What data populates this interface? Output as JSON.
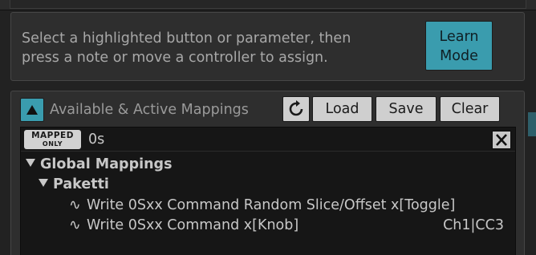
{
  "hint": {
    "line1": "Select a highlighted button or parameter, then",
    "line2": "press a note or move a controller to assign.",
    "learn_line1": "Learn",
    "learn_line2": "Mode"
  },
  "mappings_panel": {
    "title": "Available & Active Mappings",
    "load_label": "Load",
    "save_label": "Save",
    "clear_label": "Clear",
    "mapped_only_line1": "MAPPED",
    "mapped_only_line2": "ONLY",
    "filter_value": "0s",
    "tree": {
      "group_label": "Global Mappings",
      "subgroup_label": "Paketti",
      "items": [
        {
          "label": "Write 0Sxx Command Random Slice/Offset x[Toggle]",
          "assignment": ""
        },
        {
          "label": "Write 0Sxx Command x[Knob]",
          "assignment": "Ch1|CC3"
        }
      ]
    }
  },
  "colors": {
    "accent": "#3a9cae",
    "panel_bg": "#2e2e2e",
    "list_bg": "#161616",
    "text": "#c8c8c8"
  },
  "icons": {
    "collapse": "triangle-up-icon",
    "refresh": "refresh-icon",
    "clear_filter": "close-icon",
    "expand": "triangle-down-icon",
    "mapping": "wave-icon"
  }
}
